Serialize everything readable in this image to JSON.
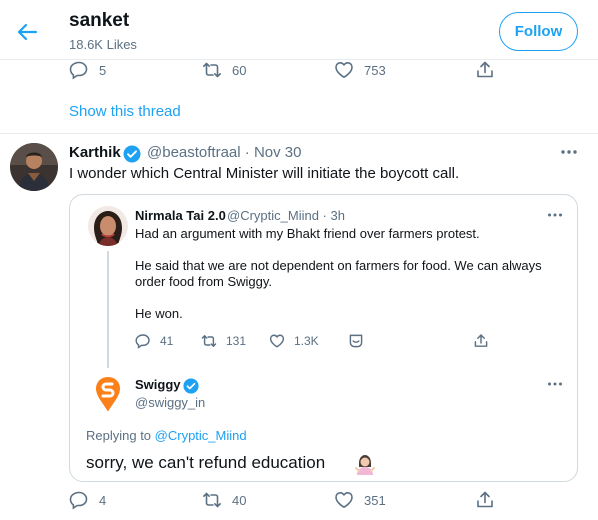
{
  "header": {
    "name": "sanket",
    "likes": "18.6K Likes",
    "follow_label": "Follow"
  },
  "prev_tweet_actions": {
    "replies": "5",
    "retweets": "60",
    "likes": "753"
  },
  "show_thread_label": "Show this thread",
  "tweet": {
    "name": "Karthik",
    "handle_time": "@beastoftraal · Nov 30",
    "text": "I wonder which Central Minister will initiate the boycott call.",
    "actions": {
      "replies": "4",
      "retweets": "40",
      "likes": "351"
    }
  },
  "quoted": {
    "name": "Nirmala Tai 2.0",
    "handle_time": "@Cryptic_Miind · 3h",
    "line1": "Had an argument with my Bhakt friend over farmers protest.",
    "line2": "He said that we are not dependent on farmers for food. We can always",
    "line3": "order food from Swiggy.",
    "line4": "He won.",
    "actions": {
      "replies": "41",
      "retweets": "131",
      "likes": "1.3K"
    }
  },
  "reply": {
    "name": "Swiggy",
    "handle": "@swiggy_in",
    "replying_prefix": "Replying to ",
    "replying_handle": "@Cryptic_Miind",
    "text": "sorry, we can't refund education"
  },
  "colors": {
    "accent": "#1da1f2",
    "muted": "#5b7083",
    "swiggy_orange": "#fc8019"
  }
}
